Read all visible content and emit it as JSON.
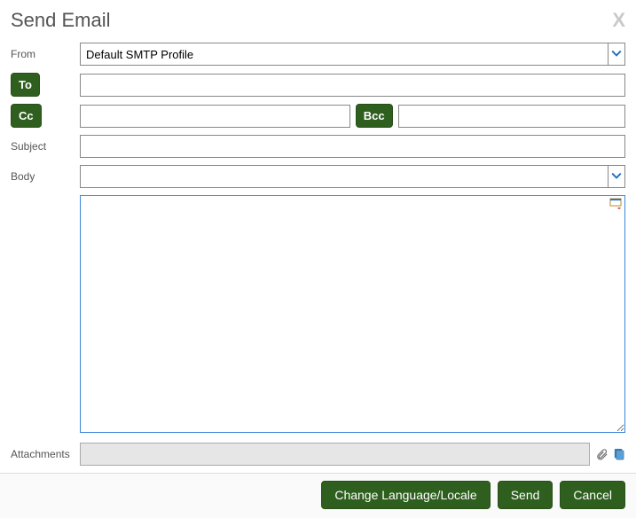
{
  "dialog": {
    "title": "Send Email",
    "close_glyph": "X"
  },
  "labels": {
    "from": "From",
    "to": "To",
    "cc": "Cc",
    "bcc": "Bcc",
    "subject": "Subject",
    "body": "Body",
    "attachments": "Attachments"
  },
  "fields": {
    "from_value": "Default SMTP Profile",
    "to_value": "",
    "cc_value": "",
    "bcc_value": "",
    "subject_value": "",
    "body_template_value": "",
    "body_text": "",
    "attachments_value": ""
  },
  "footer": {
    "change_locale": "Change Language/Locale",
    "send": "Send",
    "cancel": "Cancel"
  },
  "colors": {
    "button_bg": "#2f5f1f",
    "focus_border": "#3a87d8"
  }
}
